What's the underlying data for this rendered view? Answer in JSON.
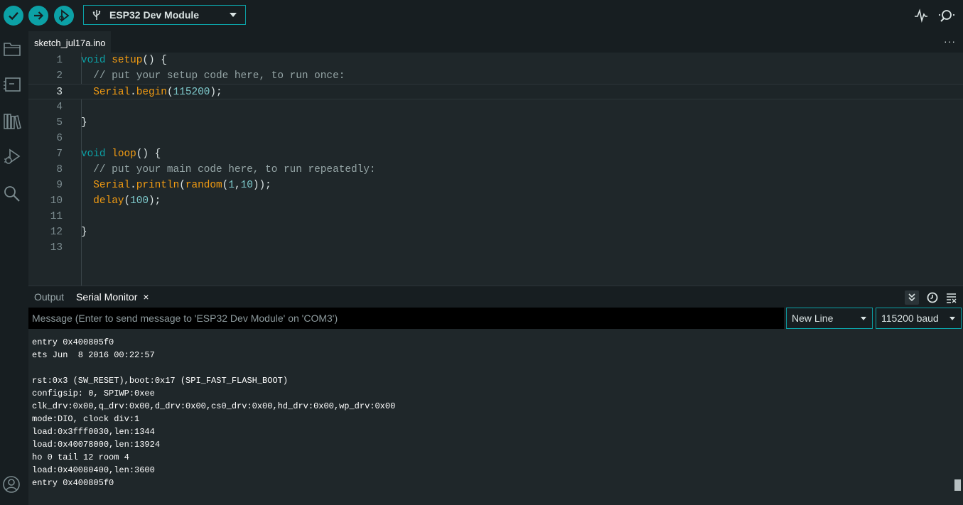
{
  "toolbar": {
    "verify_icon": "checkmark-icon",
    "upload_icon": "arrow-right-icon",
    "debug_icon": "debug-icon",
    "board_name": "ESP32 Dev Module",
    "serial_plotter_icon": "pulse-icon",
    "serial_monitor_icon": "magnifier-dots-icon"
  },
  "activity_bar": [
    "folder-icon",
    "board-manager-icon",
    "library-icon",
    "debug-icon",
    "search-icon",
    "account-icon"
  ],
  "tabs": {
    "active": "sketch_jul17a.ino",
    "more": "···"
  },
  "editor": {
    "active_line": 3,
    "lines": [
      {
        "n": "1"
      },
      {
        "n": "2"
      },
      {
        "n": "3"
      },
      {
        "n": "4"
      },
      {
        "n": "5"
      },
      {
        "n": "6"
      },
      {
        "n": "7"
      },
      {
        "n": "8"
      },
      {
        "n": "9"
      },
      {
        "n": "10"
      },
      {
        "n": "11"
      },
      {
        "n": "12"
      },
      {
        "n": "13"
      }
    ],
    "code": {
      "l1_kw": "void",
      "l1_fn": "setup",
      "l1_rest": "() {",
      "l2": "  // put your setup code here, to run once:",
      "l3_obj": "Serial",
      "l3_dot": ".",
      "l3_fn": "begin",
      "l3_open": "(",
      "l3_num": "115200",
      "l3_close": ");",
      "l5": "}",
      "l7_kw": "void",
      "l7_fn": "loop",
      "l7_rest": "() {",
      "l8": "  // put your main code here, to run repeatedly:",
      "l9_obj": "Serial",
      "l9_dot": ".",
      "l9_fn": "println",
      "l9_open": "(",
      "l9_fn2": "random",
      "l9_open2": "(",
      "l9_n1": "1",
      "l9_comma": ",",
      "l9_n2": "10",
      "l9_close": "));",
      "l10_fn": "delay",
      "l10_open": "(",
      "l10_num": "100",
      "l10_close": ");",
      "l12": "}"
    }
  },
  "panel": {
    "output_tab": "Output",
    "serial_tab": "Serial Monitor",
    "close": "×",
    "message_placeholder": "Message (Enter to send message to 'ESP32 Dev Module' on 'COM3')",
    "line_ending": "New Line",
    "baud": "115200 baud",
    "icons": [
      "autoscroll-icon",
      "timestamp-icon",
      "clear-output-icon"
    ]
  },
  "console": [
    "entry 0x400805f0",
    "ets Jun  8 2016 00:22:57",
    "",
    "rst:0x3 (SW_RESET),boot:0x17 (SPI_FAST_FLASH_BOOT)",
    "configsip: 0, SPIWP:0xee",
    "clk_drv:0x00,q_drv:0x00,d_drv:0x00,cs0_drv:0x00,hd_drv:0x00,wp_drv:0x00",
    "mode:DIO, clock div:1",
    "load:0x3fff0030,len:1344",
    "load:0x40078000,len:13924",
    "ho 0 tail 12 room 4",
    "load:0x40080400,len:3600",
    "entry 0x400805f0"
  ],
  "colors": {
    "accent": "#0ca1a6",
    "keyword": "#0ca1a6",
    "function": "#f39c12",
    "comment": "#95a5a6",
    "number": "#7fcbcd"
  }
}
